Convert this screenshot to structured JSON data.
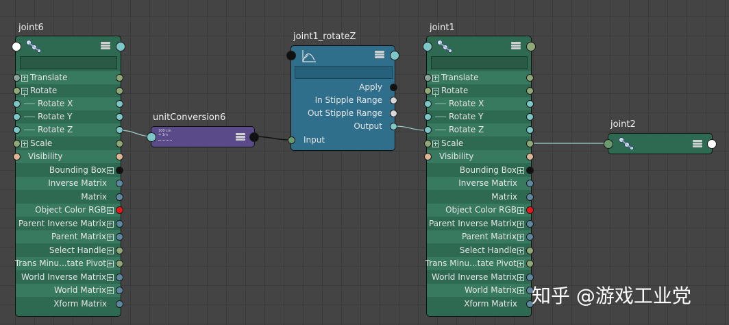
{
  "colors": {
    "background": "#444444",
    "joint_node": "#2e6a51",
    "rotate_node": "#2f6f8c",
    "conversion_node": "#5b4a8a",
    "wire": "#9fd0c8"
  },
  "nodes": {
    "joint6": {
      "title": "joint6",
      "icon": "joint-icon"
    },
    "unitConversion": {
      "title": "unitConversion6",
      "icon_text_1": "100 cm",
      "icon_text_2": "= 1m",
      "icon": "unit-conversion-icon"
    },
    "rotate": {
      "title": "joint1_rotateZ",
      "icon": "angle-curve-icon",
      "rows": {
        "apply": "Apply",
        "in_stipple": "In Stipple Range",
        "out_stipple": "Out Stipple Range",
        "output": "Output",
        "input": "Input"
      }
    },
    "joint1": {
      "title": "joint1",
      "icon": "joint-icon"
    },
    "joint2": {
      "title": "joint2",
      "icon": "joint-icon"
    }
  },
  "attributes": {
    "translate": "Translate",
    "rotate": "Rotate",
    "rotate_x": "Rotate X",
    "rotate_y": "Rotate Y",
    "rotate_z": "Rotate Z",
    "scale": "Scale",
    "visibility": "Visibility",
    "bounding_box": "Bounding Box",
    "inverse_matrix": "Inverse Matrix",
    "matrix": "Matrix",
    "object_color_rgb": "Object Color RGB",
    "parent_inverse_matrix": "Parent Inverse Matrix",
    "parent_matrix": "Parent Matrix",
    "select_handle": "Select Handle",
    "trans_minus_rotate_pivot": "Trans Minu...tate Pivot",
    "world_inverse_matrix": "World Inverse Matrix",
    "world_matrix": "World Matrix",
    "xform_matrix": "Xform Matrix"
  },
  "watermark": "知乎 @游戏工业党"
}
